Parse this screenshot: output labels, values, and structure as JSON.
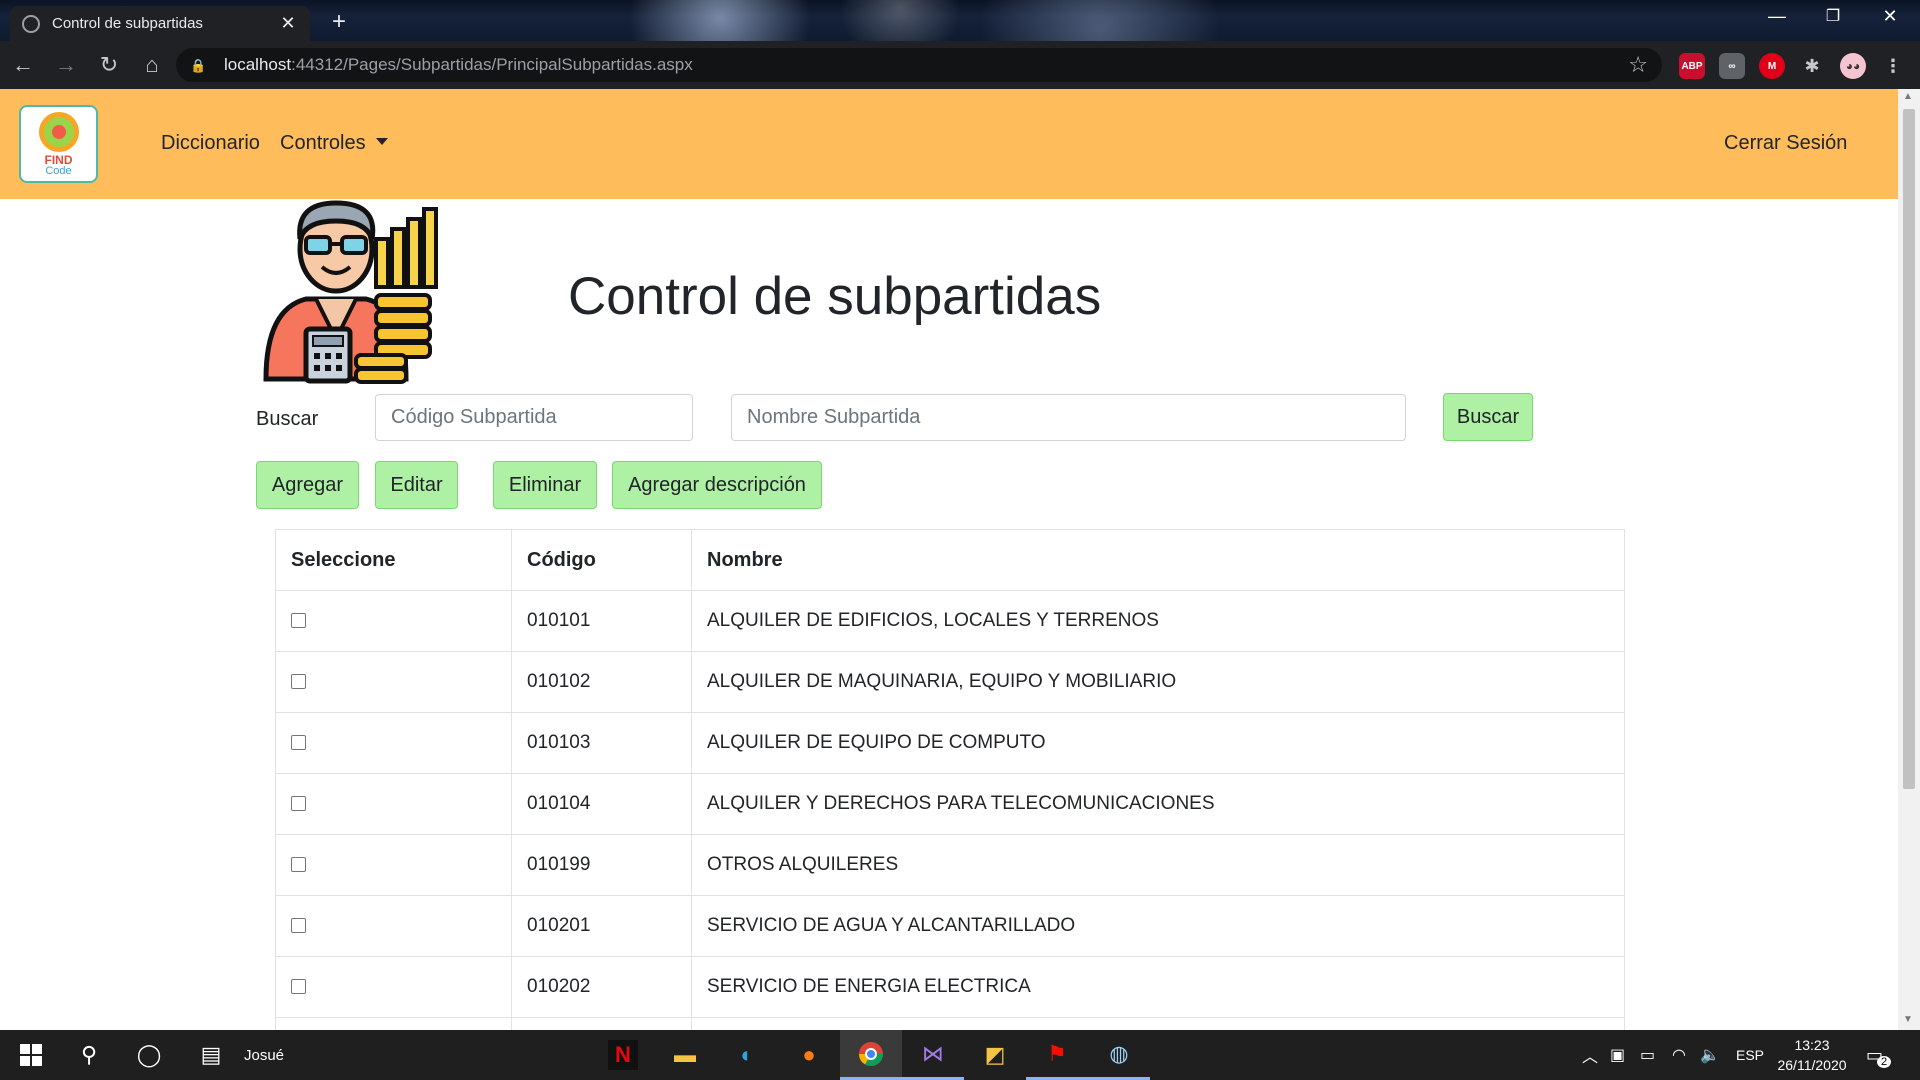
{
  "browser": {
    "tab_title": "Control de subpartidas",
    "url_host": "localhost",
    "url_rest": ":44312/Pages/Subpartidas/PrincipalSubpartidas.aspx",
    "extensions": [
      "ABP",
      "∞",
      "M"
    ]
  },
  "navbar": {
    "logo_line1": "FIND",
    "logo_line2": "Code",
    "links": [
      "Diccionario",
      "Controles"
    ],
    "logout": "Cerrar Sesión"
  },
  "page": {
    "title": "Control de subpartidas",
    "search_label": "Buscar",
    "codigo_placeholder": "Código Subpartida",
    "nombre_placeholder": "Nombre Subpartida",
    "search_button": "Buscar",
    "actions": [
      "Agregar",
      "Editar",
      "Eliminar",
      "Agregar descripción"
    ]
  },
  "table": {
    "headers": [
      "Seleccione",
      "Código",
      "Nombre"
    ],
    "rows": [
      {
        "codigo": "010101",
        "nombre": "ALQUILER DE EDIFICIOS, LOCALES Y TERRENOS"
      },
      {
        "codigo": "010102",
        "nombre": "ALQUILER DE MAQUINARIA, EQUIPO Y MOBILIARIO"
      },
      {
        "codigo": "010103",
        "nombre": "ALQUILER DE EQUIPO DE COMPUTO"
      },
      {
        "codigo": "010104",
        "nombre": "ALQUILER Y DERECHOS PARA TELECOMUNICACIONES"
      },
      {
        "codigo": "010199",
        "nombre": "OTROS ALQUILERES"
      },
      {
        "codigo": "010201",
        "nombre": "SERVICIO DE AGUA Y ALCANTARILLADO"
      },
      {
        "codigo": "010202",
        "nombre": "SERVICIO DE ENERGIA ELECTRICA"
      }
    ]
  },
  "taskbar": {
    "search_text": "Josué",
    "language": "ESP",
    "time": "13:23",
    "date": "26/11/2020",
    "notifications": "2"
  },
  "colors": {
    "navbar": "#ffbc5b",
    "button": "#aef0a4",
    "button_border": "#7bd870"
  }
}
